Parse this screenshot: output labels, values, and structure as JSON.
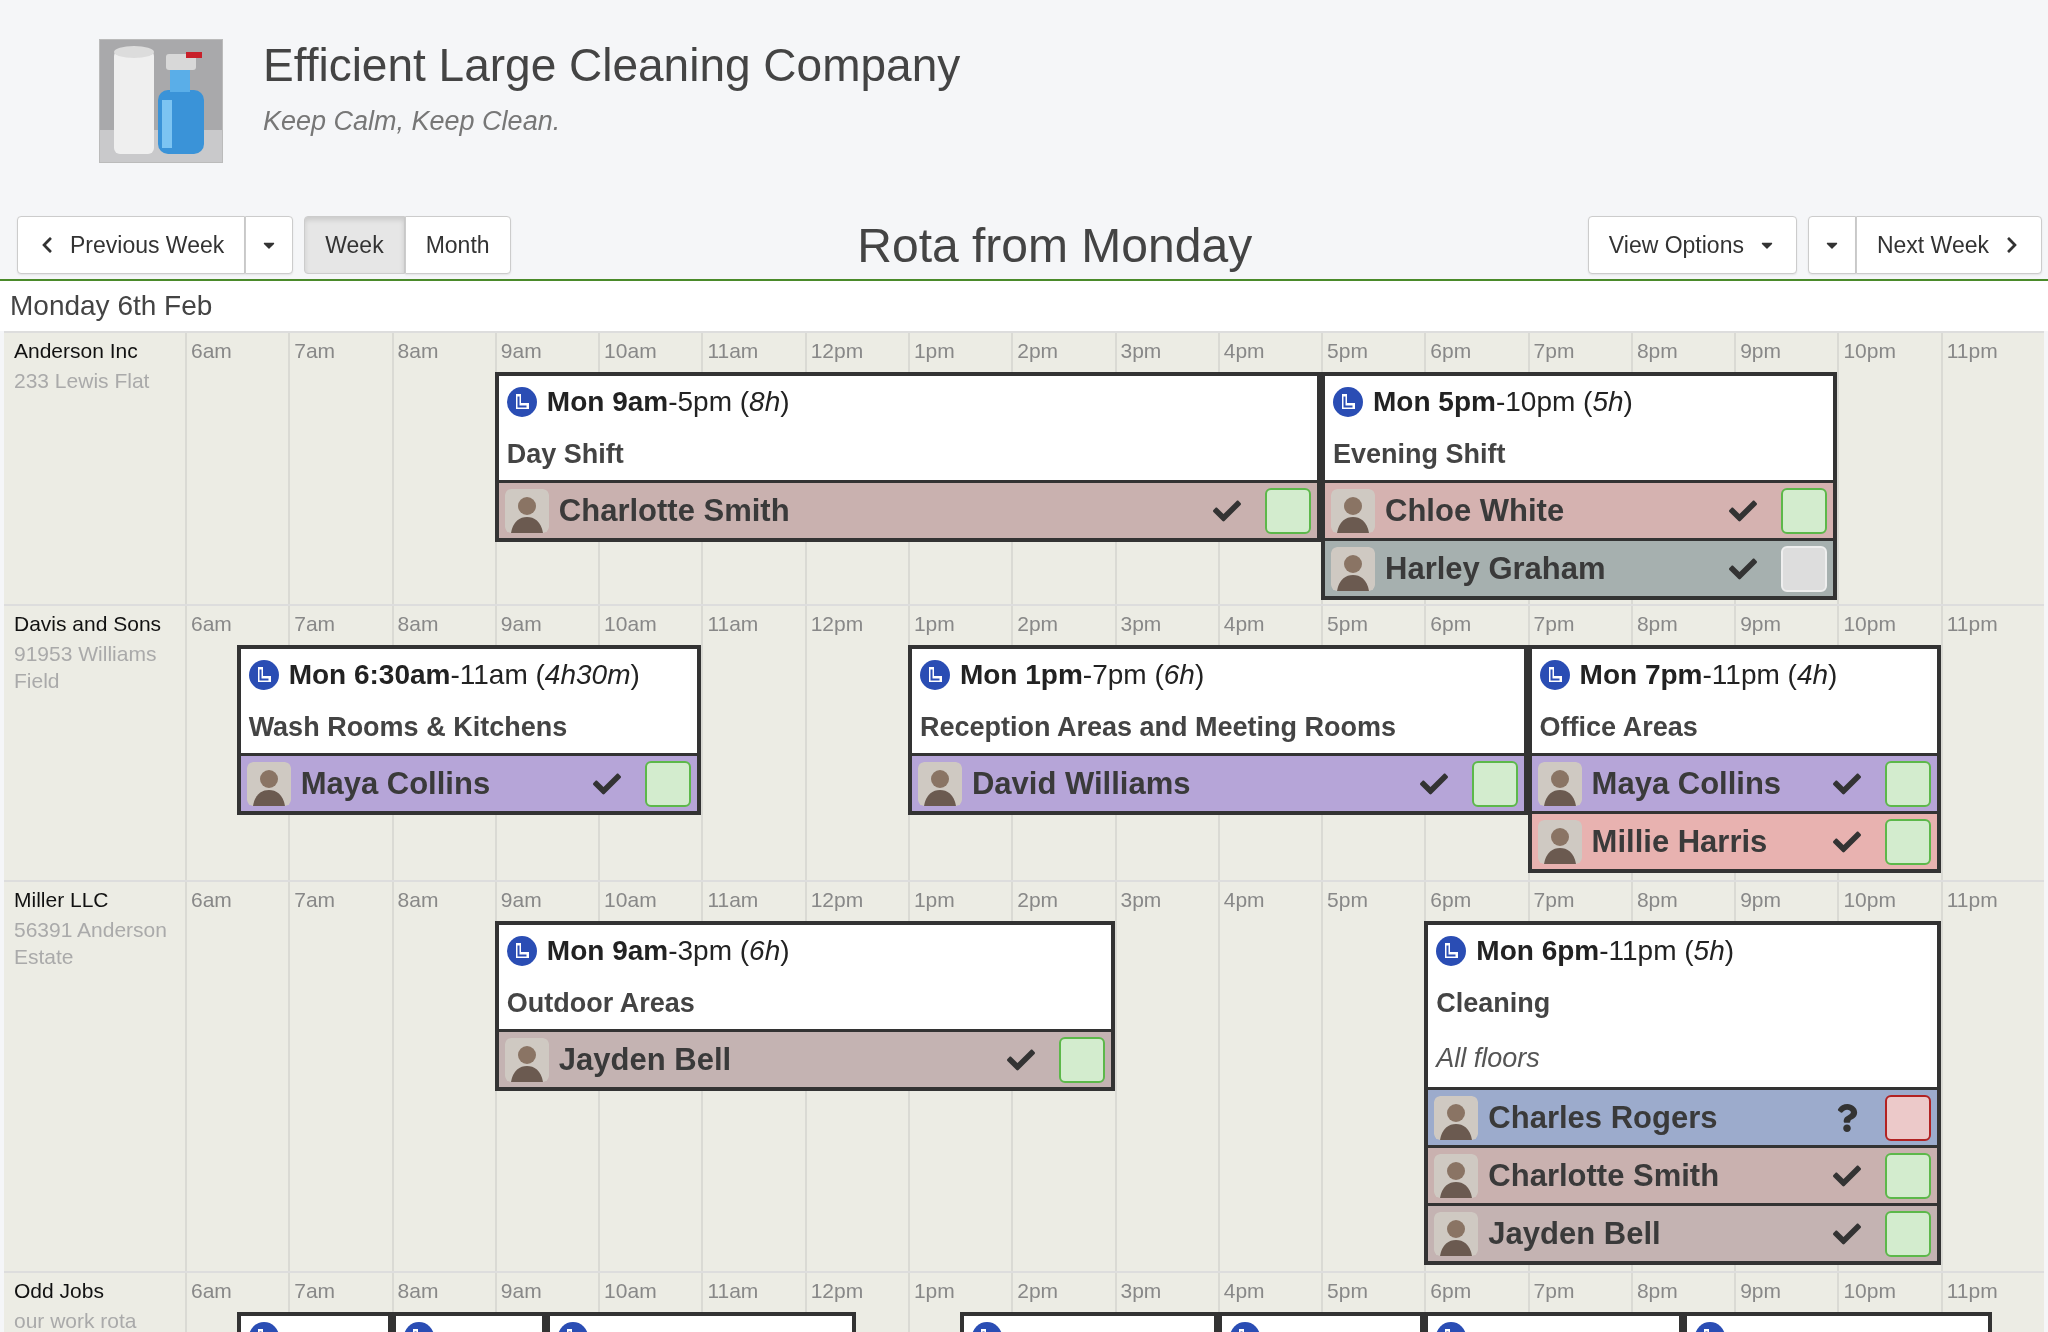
{
  "header": {
    "company": "Efficient Large Cleaning Company",
    "tagline": "Keep Calm, Keep Clean."
  },
  "toolbar": {
    "previous": "Previous Week",
    "views": [
      {
        "label": "Week",
        "selected": true
      },
      {
        "label": "Month",
        "selected": false
      }
    ],
    "title": "Rota from Monday",
    "view_options": "View Options",
    "next": "Next Week"
  },
  "day": "Monday 6th Feb",
  "sites": [
    {
      "name": "Anderson Inc",
      "address": "233 Lewis Flat",
      "hours": [
        "6am",
        "7am",
        "8am",
        "9am",
        "10am",
        "11am",
        "12pm",
        "1pm",
        "2pm",
        "3pm",
        "4pm",
        "5pm",
        "6pm",
        "7pm",
        "8pm",
        "9pm",
        "10pm",
        "11pm"
      ],
      "shifts": [
        {
          "time": "**Mon 9am**-5pm (*8h*)",
          "title": "Day Shift",
          "workers": [
            {
              "name": "Charlotte Smith",
              "color": "#c9b1af",
              "confirmed": true,
              "accepted": true,
              "declined": false
            }
          ]
        },
        {
          "time": "**Mon 5pm**-10pm (*5h*)",
          "title": "Evening Shift",
          "workers": [
            {
              "name": "Chloe White",
              "color": "#d5b2b0",
              "confirmed": true,
              "accepted": true,
              "declined": false
            },
            {
              "name": "Harley Graham",
              "color": "#a6b0af",
              "confirmed": true,
              "accepted": false,
              "declined": false
            }
          ]
        }
      ]
    },
    {
      "name": "Davis and Sons",
      "address": "91953 Williams Field",
      "hours": [
        "6am",
        "7am",
        "8am",
        "9am",
        "10am",
        "11am",
        "12pm",
        "1pm",
        "2pm",
        "3pm",
        "4pm",
        "5pm",
        "6pm",
        "7pm",
        "8pm",
        "9pm",
        "10pm",
        "11pm"
      ],
      "shifts": [
        {
          "time": "**Mon 6:30am**-11am (*4h30m*)",
          "title": "Wash Rooms & Kitchens",
          "workers": [
            {
              "name": "Maya Collins",
              "color": "#b6a5d8",
              "confirmed": true,
              "accepted": true,
              "declined": false
            }
          ]
        },
        {
          "time": "**Mon 1pm**-7pm (*6h*)",
          "title": "Reception Areas and Meeting Rooms",
          "workers": [
            {
              "name": "David Williams",
              "color": "#b6a5d8",
              "confirmed": true,
              "accepted": true,
              "declined": false
            }
          ]
        },
        {
          "time": "**Mon 7pm**-11pm (*4h*)",
          "title": "Office Areas",
          "workers": [
            {
              "name": "Maya Collins",
              "color": "#b6a5d8",
              "confirmed": true,
              "accepted": true,
              "declined": false
            },
            {
              "name": "Millie Harris",
              "color": "#e8b2b0",
              "confirmed": true,
              "accepted": true,
              "declined": false
            }
          ]
        }
      ]
    },
    {
      "name": "Miller LLC",
      "address": "56391 Anderson Estate",
      "hours": [
        "6am",
        "7am",
        "8am",
        "9am",
        "10am",
        "11am",
        "12pm",
        "1pm",
        "2pm",
        "3pm",
        "4pm",
        "5pm",
        "6pm",
        "7pm",
        "8pm",
        "9pm",
        "10pm",
        "11pm"
      ],
      "shifts": [
        {
          "time": "**Mon 9am**-3pm (*6h*)",
          "title": "Outdoor Areas",
          "workers": [
            {
              "name": "Jayden Bell",
              "color": "#c4b3b2",
              "confirmed": true,
              "accepted": true,
              "declined": false
            }
          ]
        },
        {
          "time": "**Mon 6pm**-11pm (*5h*)",
          "title": "Cleaning",
          "note": "All floors",
          "workers": [
            {
              "name": "Charles Rogers",
              "color": "#9cabcc",
              "confirmed": false,
              "accepted": false,
              "declined": true
            },
            {
              "name": "Charlotte Smith",
              "color": "#c9b1af",
              "confirmed": true,
              "accepted": true,
              "declined": false
            },
            {
              "name": "Jayden Bell",
              "color": "#c4b3b2",
              "confirmed": true,
              "accepted": true,
              "declined": false
            }
          ]
        }
      ]
    },
    {
      "name": "Odd Jobs",
      "address": "our work rota",
      "hours": [
        "6am",
        "7am",
        "8am",
        "9am",
        "10am",
        "11am",
        "12pm",
        "1pm",
        "2pm",
        "3pm",
        "4pm",
        "5pm",
        "6pm",
        "7pm",
        "8pm",
        "9pm",
        "10pm",
        "11pm"
      ]
    }
  ]
}
